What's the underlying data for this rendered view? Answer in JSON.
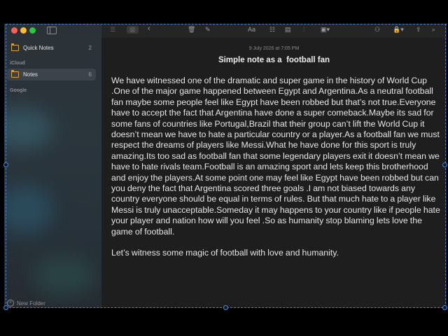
{
  "sidebar": {
    "items": [
      {
        "label": "Quick Notes",
        "count": "2"
      },
      {
        "label": "Notes",
        "count": "6"
      }
    ],
    "sections": [
      "iCloud",
      "Google"
    ],
    "new_folder_label": "New Folder"
  },
  "note": {
    "date": "9 July 2026 at 7:05 PM",
    "title": "Simple note as a  football fan",
    "paragraphs": [
      "We have witnessed one of the dramatic and super game in the history of World Cup   .One of the major game happened between Egypt and Argentina.As a neutral football fan maybe some people feel like Egypt have been robbed but that’s not true.Everyone have to accept the fact that Argentina have done a super comeback.Maybe its sad for some fans of countries like Portugal,Brazil that their group can’t lift the World Cup it doesn’t mean we have to hate a particular country or a player.As a football fan we must respect the dreams of players like Messi.What he have done for this sport is truly amazing.Its too sad as football fan that some legendary players exit it doesn’t mean we have to hate rivals team.Football is an amazing sport and lets keep this brotherhood and enjoy the players.At some point one may feel like Egypt have been robbed but can you deny the fact that Argentina scored three goals .I am not biased towards any country everyone should be equal in terms of rules. But that much hate to a player like Messi is truly unacceptable.Someday it may happens to your country like if people hate your player and nation how will you feel .So as humanity stop blaming lets love the game of football.",
      "Let’s witness some magic of football with love and humanity."
    ]
  },
  "colors": {
    "close": "#ff5f57",
    "minimize": "#febc2e",
    "zoom": "#28c840",
    "folder": "#e1a43b",
    "selection": "#4f86d9"
  }
}
